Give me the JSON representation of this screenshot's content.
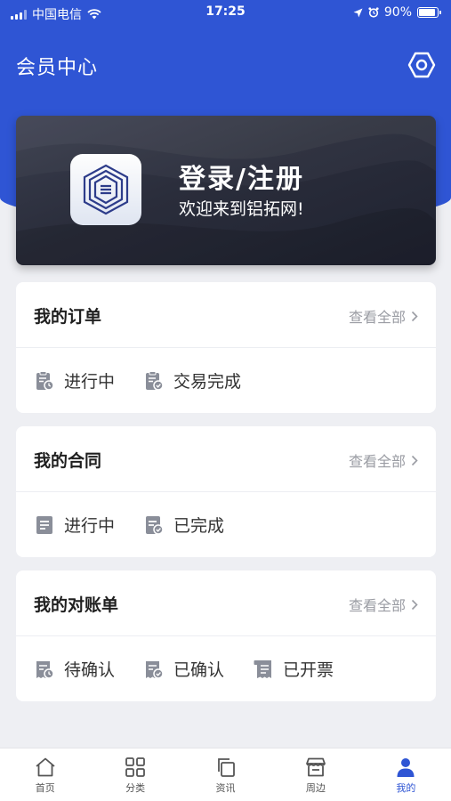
{
  "status_bar": {
    "carrier": "中国电信",
    "time": "17:25",
    "battery": "90%",
    "battery_level": 0.9
  },
  "header": {
    "title": "会员中心",
    "settings_icon": "settings-hexagon-icon"
  },
  "login_card": {
    "title": "登录/注册",
    "subtitle": "欢迎来到铝拓网!",
    "logo_icon": "logo-cube-icon"
  },
  "sections": [
    {
      "title": "我的订单",
      "more": "查看全部",
      "entries": [
        {
          "label": "进行中",
          "icon": "clipboard-clock-icon"
        },
        {
          "label": "交易完成",
          "icon": "clipboard-check-icon"
        }
      ]
    },
    {
      "title": "我的合同",
      "more": "查看全部",
      "entries": [
        {
          "label": "进行中",
          "icon": "document-lines-icon"
        },
        {
          "label": "已完成",
          "icon": "document-check-icon"
        }
      ]
    },
    {
      "title": "我的对账单",
      "more": "查看全部",
      "entries": [
        {
          "label": "待确认",
          "icon": "statement-clock-icon"
        },
        {
          "label": "已确认",
          "icon": "statement-check-icon"
        },
        {
          "label": "已开票",
          "icon": "receipt-icon"
        }
      ]
    }
  ],
  "tabbar": [
    {
      "label": "首页",
      "icon": "home-icon",
      "active": false
    },
    {
      "label": "分类",
      "icon": "grid-icon",
      "active": false
    },
    {
      "label": "资讯",
      "icon": "copy-icon",
      "active": false
    },
    {
      "label": "周边",
      "icon": "store-icon",
      "active": false
    },
    {
      "label": "我的",
      "icon": "user-icon",
      "active": true
    }
  ],
  "colors": {
    "primary": "#2f55d4",
    "card_dark": "#2a2d3b",
    "icon_gray": "#8a8e99",
    "background": "#eeeff3"
  }
}
